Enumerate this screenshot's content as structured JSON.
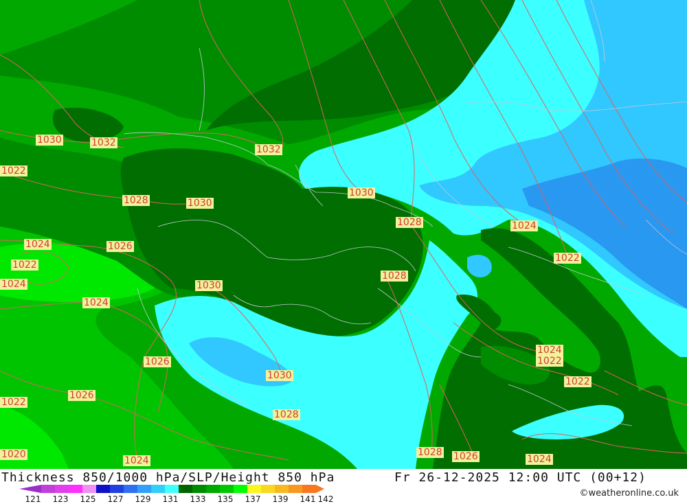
{
  "map": {
    "isobar_labels": [
      "1030",
      "1032",
      "1032",
      "1028",
      "1030",
      "1030",
      "1028",
      "1024",
      "1026",
      "1022",
      "1024",
      "1030",
      "1028",
      "1024",
      "1022",
      "1024",
      "1022",
      "1022",
      "1026",
      "1030",
      "1026",
      "1028",
      "1028",
      "1026",
      "1024",
      "1024",
      "1022",
      "1020",
      "1024",
      "1022"
    ],
    "legend": {
      "tick_labels": [
        "121",
        "123",
        "125",
        "127",
        "129",
        "131",
        "133",
        "135",
        "137",
        "139",
        "141",
        "142"
      ],
      "colors": [
        "#9b30c8",
        "#c040d8",
        "#e040ec",
        "#ff30ff",
        "#f090f0",
        "#1010c8",
        "#2040e0",
        "#3070f0",
        "#30a0f8",
        "#30d0f8",
        "#40ffff",
        "#006400",
        "#008c00",
        "#00a800",
        "#00c800",
        "#00ff00",
        "#f8f820",
        "#f8d820",
        "#f8b820",
        "#f89820",
        "#f87820"
      ]
    },
    "palette": {
      "green_darkest": "#006e00",
      "green_dark": "#008c00",
      "green_mid": "#00a800",
      "green_light": "#00c400",
      "green_lightest": "#00e800",
      "cyan": "#3cffff",
      "blue_light": "#30c8ff",
      "blue_mid": "#2898f0",
      "isobar": "#e06060",
      "border": "#c8c8d8"
    }
  },
  "footer": {
    "title": "Thickness 850/1000 hPa/SLP/Height 850 hPa",
    "datetime": "Fr 26-12-2025 12:00 UTC (00+12)",
    "credit": "©weatheronline.co.uk"
  }
}
